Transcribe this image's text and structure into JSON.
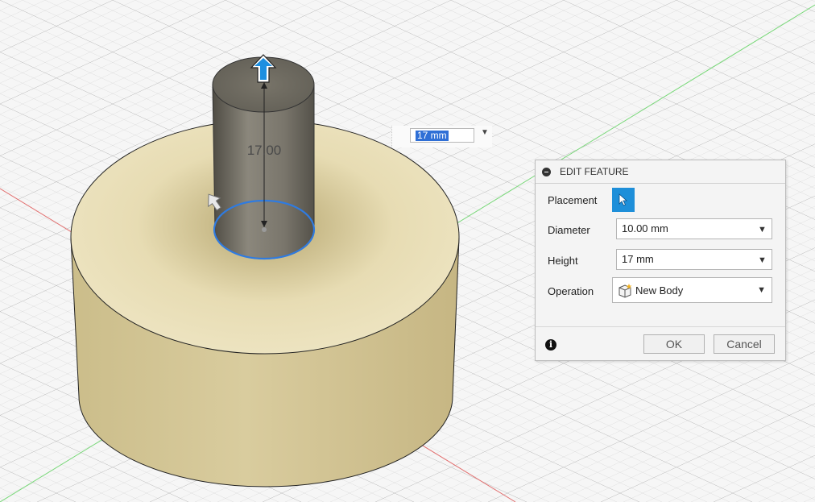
{
  "viewport": {
    "dimension_label": "17.00",
    "colors": {
      "grid": "#c4c4c4",
      "base_body": "#d9cc9d",
      "cylinder": "#7a776f",
      "selection_edge": "#2f7be0",
      "x_axis": "#e06060",
      "y_axis": "#5ccf5c"
    }
  },
  "dimension_input": {
    "value": "17 mm"
  },
  "edit_feature": {
    "title": "EDIT FEATURE",
    "placement_label": "Placement",
    "diameter_label": "Diameter",
    "diameter_value": "10.00 mm",
    "height_label": "Height",
    "height_value": "17 mm",
    "operation_label": "Operation",
    "operation_value": "New Body",
    "ok_label": "OK",
    "cancel_label": "Cancel",
    "info_glyph": "i"
  }
}
